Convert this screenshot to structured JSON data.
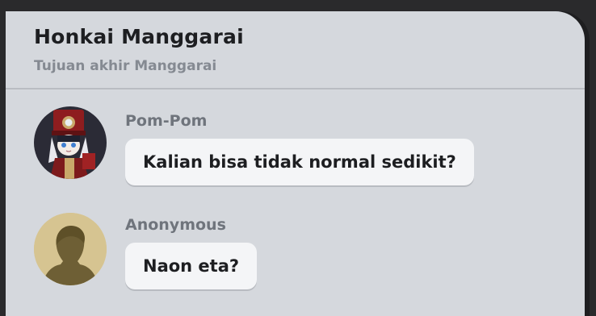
{
  "chat": {
    "title": "Honkai Manggarai",
    "subtitle": "Tujuan akhir Manggarai"
  },
  "messages": [
    {
      "sender": "Pom-Pom",
      "text": "Kalian bisa tidak normal sedikit?",
      "avatar_icon": "pom-pom-character-avatar"
    },
    {
      "sender": "Anonymous",
      "text": "Naon eta?",
      "avatar_icon": "anonymous-silhouette-avatar"
    }
  ],
  "colors": {
    "window_bg": "#d5d8dd",
    "bubble_bg": "#f4f5f7",
    "title_text": "#1d1e21",
    "secondary_text": "#858a92",
    "anonymous_avatar_bg": "#d6c491"
  }
}
